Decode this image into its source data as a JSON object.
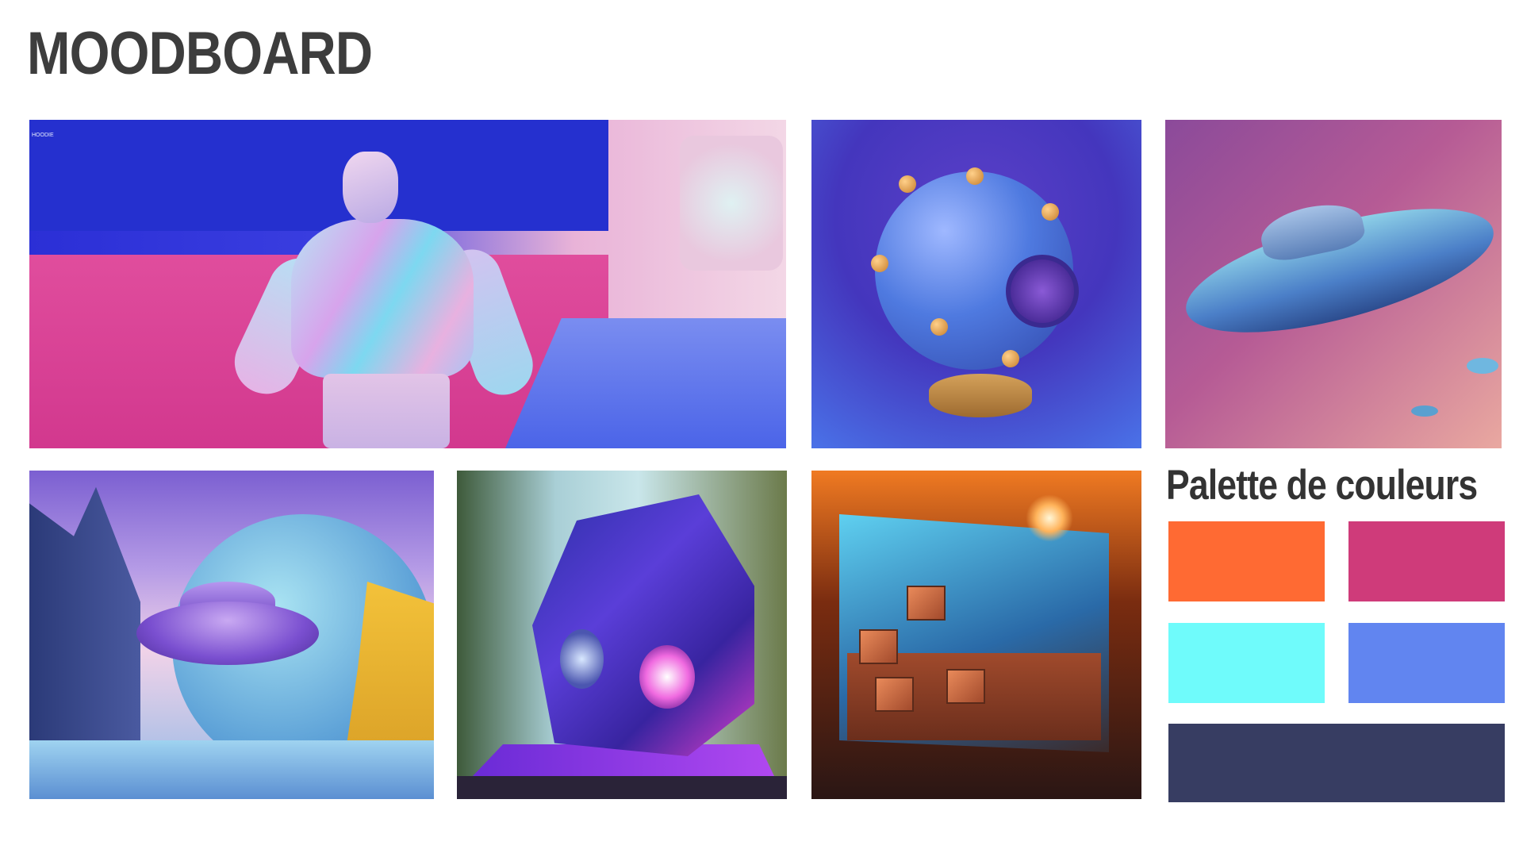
{
  "title": "MOODBOARD",
  "tiles": [
    {
      "subject": "holographic-hoodie",
      "tag": "HOODIE"
    },
    {
      "subject": "blue-sphere"
    },
    {
      "subject": "spaceship"
    },
    {
      "subject": "ufo-landscape"
    },
    {
      "subject": "purple-cube"
    },
    {
      "subject": "container-room"
    }
  ],
  "palette": {
    "title": "Palette de couleurs",
    "colors": [
      "#FF6A33",
      "#CF3B7A",
      "#6FFBFB",
      "#6185F0",
      "#373D62"
    ]
  }
}
